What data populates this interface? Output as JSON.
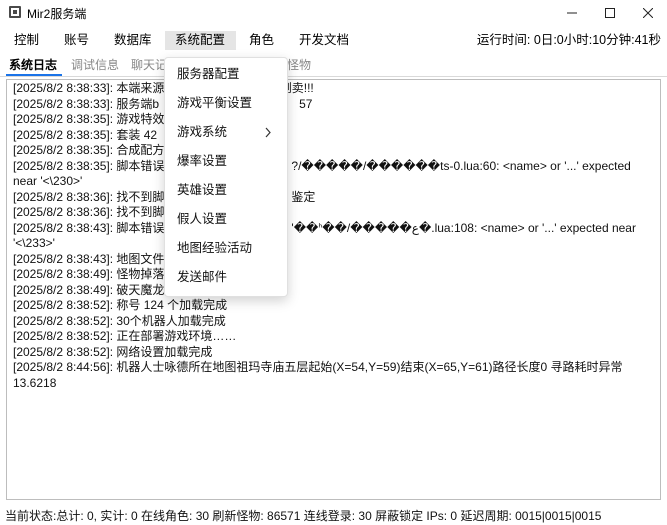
{
  "window": {
    "title": "Mir2服务端",
    "minimize_icon": "minimize-icon",
    "maximize_icon": "maximize-icon",
    "close_icon": "close-icon"
  },
  "menubar": {
    "items": [
      "控制",
      "账号",
      "数据库",
      "系统配置",
      "角色",
      "开发文档"
    ],
    "active": "系统配置",
    "runtime": "运行时间: 0日:0小时:10分钟:41秒"
  },
  "tabs": {
    "items": [
      "系统日志",
      "调试信息",
      "聊天记",
      "怪物"
    ],
    "active": "系统日志"
  },
  "dropdown": {
    "items": [
      "服务器配置",
      "游戏平衡设置",
      "游戏系统",
      "爆率设置",
      "英雄设置",
      "假人设置",
      "地图经验活动",
      "发送邮件"
    ],
    "submenu_item": "游戏系统"
  },
  "log": {
    "lines": [
      "[2025/8/2 8:38:33]: 本端来源",
      "[2025/8/2 8:38:33]: 服务端b",
      "[2025/8/2 8:38:35]: 游戏特效",
      "[2025/8/2 8:38:35]: 套装 42",
      "[2025/8/2 8:38:35]: 合成配方",
      "[2025/8/2 8:38:35]: 脚本错误",
      "near '<\\230>'",
      "[2025/8/2 8:38:36]: 找不到脚",
      "[2025/8/2 8:38:36]: 找不到脚",
      "[2025/8/2 8:38:43]: 脚本错误",
      "'<\\233>'",
      "[2025/8/2 8:38:43]: 地图文件",
      "[2025/8/2 8:38:49]: 怪物掉落",
      "[2025/8/2 8:38:49]: 破天魔龙",
      "[2025/8/2 8:38:52]: 称号 124 个加载完成",
      "[2025/8/2 8:38:52]: 30个机器人加载完成",
      "[2025/8/2 8:38:52]: 正在部署游戏环境……",
      "[2025/8/2 8:38:52]: 网络设置加载完成",
      "[2025/8/2 8:44:56]: 机器人士咏德所在地图祖玛寺庙五层起始(X=54,Y=59)结束(X=65,Y=61)路径长度0 寻路耗时异常",
      "13.6218"
    ],
    "hidden_tails": [
      ",请勿倒卖!!!",
      "57",
      "?/�����/������ts-0.lua:60: <name> or '...' expected",
      "鉴定",
      "'��ᑋ��/�����ع�.lua:108: <name> or '...' expected near"
    ]
  },
  "status": {
    "text": "当前状态:总计: 0, 实计: 0  在线角色: 30  刷新怪物: 86571  连线登录: 30  屏蔽锁定 IPs: 0  延迟周期: 0015|0015|0015"
  }
}
